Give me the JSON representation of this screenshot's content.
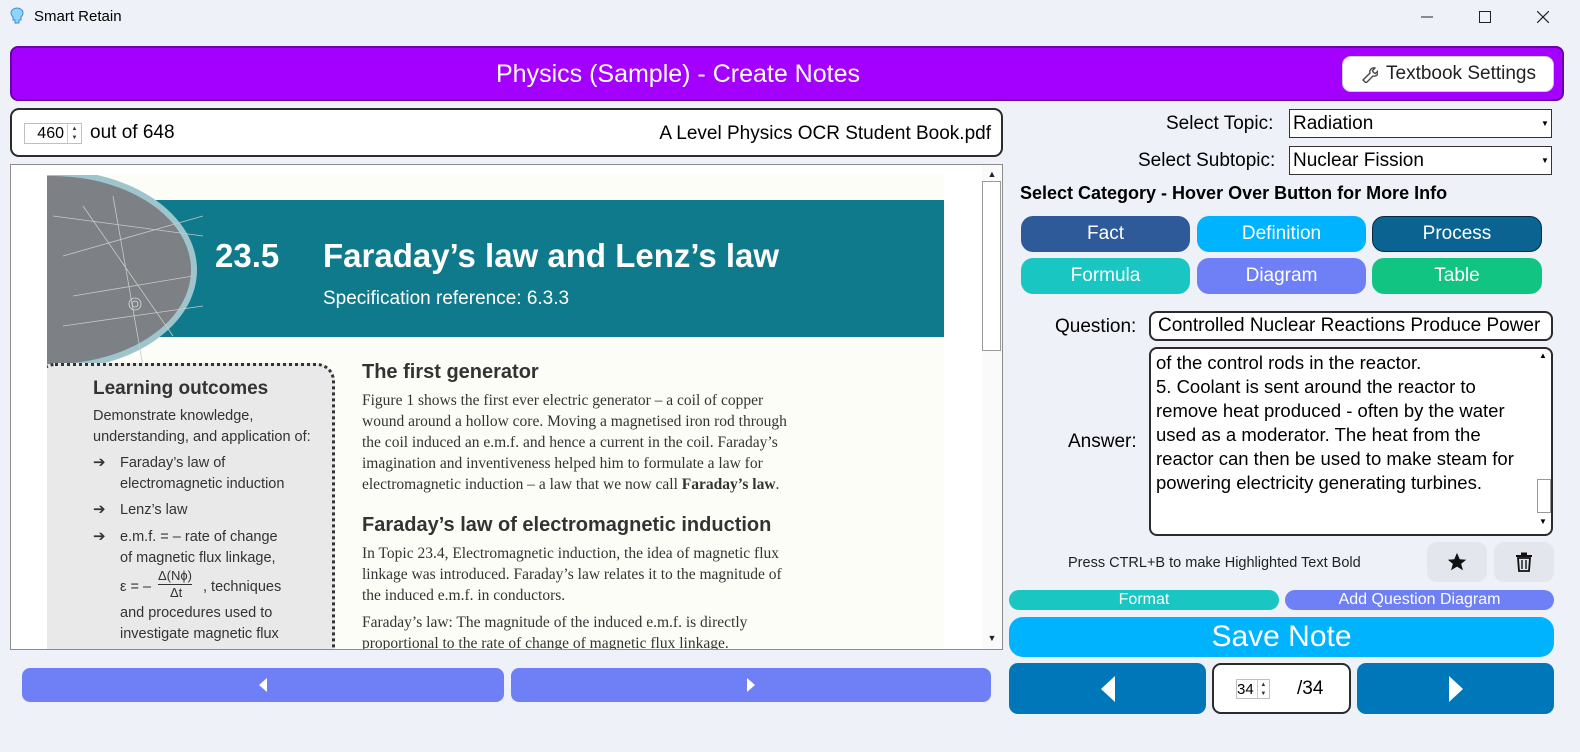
{
  "window": {
    "title": "Smart Retain"
  },
  "header": {
    "title": "Physics (Sample) - Create Notes",
    "settings_label": "Textbook Settings"
  },
  "pdf": {
    "current_page": "460",
    "page_total_text": "out of 648",
    "file_name": "A Level Physics OCR Student Book.pdf"
  },
  "page_content": {
    "section_number": "23.5",
    "section_title": "Faraday’s law and Lenz’s law",
    "spec_ref": "Specification reference: 6.3.3",
    "lo_title": "Learning outcomes",
    "lo_intro": [
      "Demonstrate knowledge,",
      "understanding, and application of:"
    ],
    "lo_items": [
      [
        "Faraday’s law of",
        "electromagnetic induction"
      ],
      [
        "Lenz’s law"
      ],
      [
        "e.m.f. = – rate of change",
        "of magnetic flux linkage,"
      ]
    ],
    "lo_formula_lead": "ε = –",
    "lo_formula_num": "Δ(Nϕ)",
    "lo_formula_den": "Δt",
    "lo_formula_tail": ", techniques",
    "lo_after": [
      "and procedures used to",
      "investigate magnetic flux"
    ],
    "heading1": "The first generator",
    "para1": [
      "Figure 1 shows the first ever electric generator – a coil of copper",
      "wound around a hollow core. Moving a magnetised iron rod through",
      "the coil induced an e.m.f. and hence a current in the coil. Faraday’s",
      "imagination and inventiveness helped him to formulate a law for"
    ],
    "para1_last": "electromagnetic induction – a law that we now call ",
    "para1_bold": "Faraday’s law",
    "para1_end": ".",
    "heading2": "Faraday’s law of electromagnetic induction",
    "para2": [
      "In Topic 23.4, Electromagnetic induction, the idea of magnetic flux",
      "linkage was introduced. Faraday’s law relates it to the magnitude of",
      "the induced e.m.f. in conductors."
    ],
    "para3": [
      "Faraday’s law: The magnitude of the induced e.m.f. is directly",
      "proportional to the rate of change of magnetic flux linkage."
    ]
  },
  "form": {
    "topic_label": "Select Topic:",
    "topic_value": "Radiation",
    "subtopic_label": "Select Subtopic:",
    "subtopic_value": "Nuclear Fission",
    "category_heading": "Select Category - Hover Over Button for More Info",
    "categories": [
      {
        "label": "Fact",
        "color": "#2e5a9a"
      },
      {
        "label": "Definition",
        "color": "#00b3ff"
      },
      {
        "label": "Process",
        "color": "#0a6390"
      },
      {
        "label": "Formula",
        "color": "#1ac6c2"
      },
      {
        "label": "Diagram",
        "color": "#6f7ff6"
      },
      {
        "label": "Table",
        "color": "#12c482"
      }
    ],
    "question_label": "Question:",
    "question_value": "Controlled Nuclear Reactions Produce Power",
    "answer_label": "Answer:",
    "answer_value": "of the control rods in the reactor.\n5. Coolant is sent around the reactor to remove heat produced - often by the water used as a moderator. The heat from the reactor can then be used to make steam for powering electricity generating turbines.",
    "bold_hint": "Press CTRL+B to make Highlighted Text Bold",
    "format_label": "Format",
    "add_diagram_label": "Add Question Diagram",
    "save_label": "Save Note",
    "note_current": "34",
    "note_total": "/34"
  },
  "colors": {
    "header": "#a300ff",
    "accent_blue": "#00b3ff",
    "nav_blue": "#0077b8",
    "nav_purple": "#6f7ff6"
  }
}
